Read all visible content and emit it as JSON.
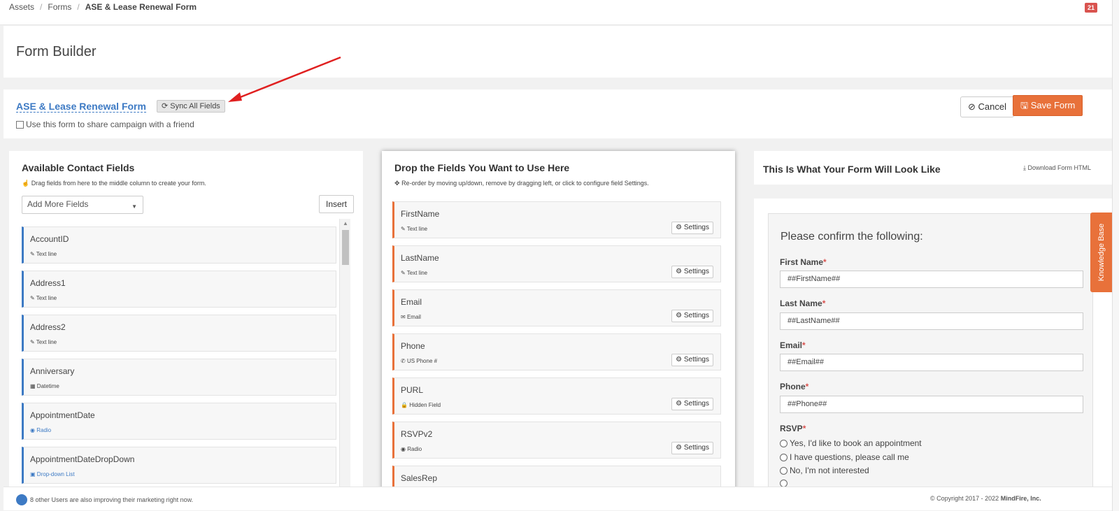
{
  "breadcrumb": {
    "items": [
      "Assets",
      "Forms"
    ],
    "current": "ASE & Lease Renewal Form"
  },
  "notification_count": "21",
  "page_title": "Form Builder",
  "form_bar": {
    "form_name": "ASE & Lease Renewal Form",
    "sync_label": "Sync All Fields",
    "share_label": "Use this form to share campaign with a friend",
    "cancel_label": "Cancel",
    "save_label": "Save Form"
  },
  "left_column": {
    "title": "Available Contact Fields",
    "subtitle": "Drag fields from here to the middle column to create your form.",
    "add_more_placeholder": "Add More Fields",
    "insert_label": "Insert",
    "fields": [
      {
        "name": "AccountID",
        "type": "Text line",
        "icon": "edit-icon"
      },
      {
        "name": "Address1",
        "type": "Text line",
        "icon": "edit-icon"
      },
      {
        "name": "Address2",
        "type": "Text line",
        "icon": "edit-icon"
      },
      {
        "name": "Anniversary",
        "type": "Datetime",
        "icon": "calendar-icon"
      },
      {
        "name": "AppointmentDate",
        "type": "Radio",
        "icon": "radio-icon"
      },
      {
        "name": "AppointmentDateDropDown",
        "type": "Drop-down List",
        "icon": "dropdown-icon"
      }
    ]
  },
  "middle_column": {
    "title": "Drop the Fields You Want to Use Here",
    "subtitle": "Re-order by moving up/down, remove by dragging left, or click to configure field Settings.",
    "settings_label": "Settings",
    "fields": [
      {
        "name": "FirstName",
        "type": "Text line",
        "icon": "edit-icon"
      },
      {
        "name": "LastName",
        "type": "Text line",
        "icon": "edit-icon"
      },
      {
        "name": "Email",
        "type": "Email",
        "icon": "envelope-icon"
      },
      {
        "name": "Phone",
        "type": "US Phone #",
        "icon": "phone-icon"
      },
      {
        "name": "PURL",
        "type": "Hidden Field",
        "icon": "lock-icon"
      },
      {
        "name": "RSVPv2",
        "type": "Radio",
        "icon": "radio-icon"
      },
      {
        "name": "SalesRep",
        "type": "",
        "icon": ""
      }
    ]
  },
  "preview": {
    "title": "This Is What Your Form Will Look Like",
    "download_label": "Download Form HTML",
    "confirm_title": "Please confirm the following:",
    "fields": [
      {
        "label": "First Name",
        "value": "##FirstName##"
      },
      {
        "label": "Last Name",
        "value": "##LastName##"
      },
      {
        "label": "Email",
        "value": "##Email##"
      },
      {
        "label": "Phone",
        "value": "##Phone##"
      }
    ],
    "rsvp_label": "RSVP",
    "rsvp_options": [
      "Yes, I'd like to book an appointment",
      "I have questions, please call me",
      "No, I'm not interested"
    ]
  },
  "knowledge_base_label": "Knowledge Base",
  "footer": {
    "users_text": "8 other Users are also improving their marketing right now.",
    "copyright": "© Copyright 2017 - 2022",
    "company": "MindFire, Inc."
  },
  "colors": {
    "accent": "#e8713a",
    "link": "#3d7ac4",
    "required": "#d9534f"
  }
}
